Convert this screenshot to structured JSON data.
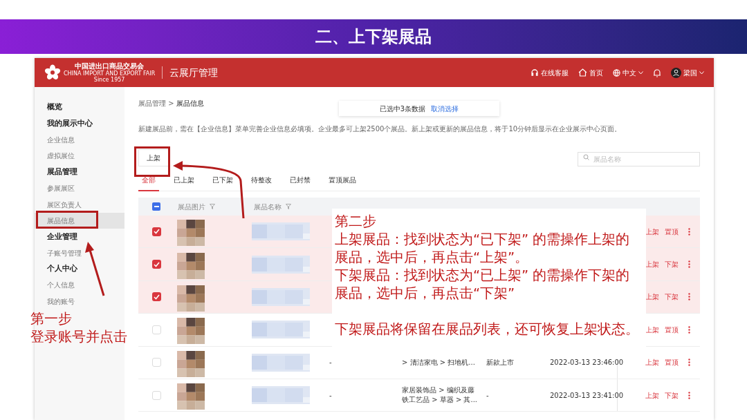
{
  "slide_title": "二、上下架展品",
  "header": {
    "logo_lines": [
      "中国进出口商品交易会",
      "CHINA IMPORT AND EXPORT FAIR",
      "Since 1957"
    ],
    "title": "云展厅管理",
    "nav": [
      {
        "kind": "headset",
        "label": "在线客服",
        "dropdown": false
      },
      {
        "kind": "home",
        "label": "首页",
        "dropdown": false
      },
      {
        "kind": "globe",
        "label": "中文",
        "dropdown": true
      }
    ],
    "user": {
      "name": "梁国",
      "dropdown": true
    }
  },
  "sidebar": [
    {
      "kind": "group",
      "label": "概览",
      "selected": false
    },
    {
      "kind": "group",
      "label": "我的展示中心",
      "selected": false
    },
    {
      "kind": "item",
      "label": "企业信息",
      "selected": false
    },
    {
      "kind": "item",
      "label": "虚拟展位",
      "selected": false
    },
    {
      "kind": "group",
      "label": "展品管理",
      "selected": false
    },
    {
      "kind": "item",
      "label": "参展展区",
      "selected": false
    },
    {
      "kind": "item",
      "label": "展区负责人",
      "selected": false
    },
    {
      "kind": "item",
      "label": "展品信息",
      "selected": true
    },
    {
      "kind": "group",
      "label": "企业管理",
      "selected": false
    },
    {
      "kind": "item",
      "label": "子账号管理",
      "selected": false
    },
    {
      "kind": "group",
      "label": "个人中心",
      "selected": false
    },
    {
      "kind": "item",
      "label": "个人信息",
      "selected": false
    },
    {
      "kind": "item",
      "label": "我的账号",
      "selected": false
    }
  ],
  "breadcrumb": {
    "parent": "展品管理",
    "separator": ">",
    "current": "展品信息"
  },
  "selection_bar": {
    "text": "已选中3条数据",
    "link": "取消选择"
  },
  "notice": "新建展品前，需在【企业信息】菜单完善企业信息必填项。企业最多可上架2500个展品。新上架或更新的展品信息，将于10分钟后显示在企业展示中心页面。",
  "action_button": "上架",
  "search": {
    "placeholder": "展品名称"
  },
  "tabs": [
    {
      "label": "全部",
      "selected": true
    },
    {
      "label": "已上架",
      "selected": false
    },
    {
      "label": "已下架",
      "selected": false
    },
    {
      "label": "待整改",
      "selected": false
    },
    {
      "label": "已封禁",
      "selected": false
    },
    {
      "label": "置顶展品",
      "selected": false
    }
  ],
  "table": {
    "select_all_indeterminate": true,
    "columns": [
      "展品图片",
      "展品名称"
    ],
    "rows": [
      {
        "selected": true,
        "actions": [
          "上架",
          "置顶"
        ]
      },
      {
        "selected": true,
        "actions": [
          "上架",
          "下架"
        ]
      },
      {
        "selected": true,
        "actions": [
          "上架",
          "下架"
        ]
      },
      {
        "selected": false,
        "actions": [
          "上架",
          "置顶"
        ]
      },
      {
        "selected": false,
        "column_4": "-",
        "category": "> 清洁家电 > 扫地机...",
        "tag": "新款上市",
        "time": "2022-03-13 23:46:00",
        "actions": [
          "上架",
          "置顶"
        ]
      },
      {
        "selected": false,
        "column_4": "-",
        "category": "家居装饰品 > 编织及藤铁工艺品 > 草器 > 其...",
        "tag": "-",
        "time": "2022-03-13 23:41:00",
        "actions": [
          "上架",
          "下架"
        ]
      }
    ]
  },
  "annotations": {
    "step1": {
      "title": "第一步",
      "text": "登录账号并点击"
    },
    "step2": {
      "title": "第二步",
      "paragraphs": [
        "上架展品：找到状态为“已下架” 的需操作上架的展品，选中后，再点击“上架”。",
        "下架展品：找到状态为“已上架” 的需操作下架的展品，选中后，再点击“下架”",
        "下架展品将保留在展品列表，还可恢复上架状态。"
      ]
    }
  }
}
